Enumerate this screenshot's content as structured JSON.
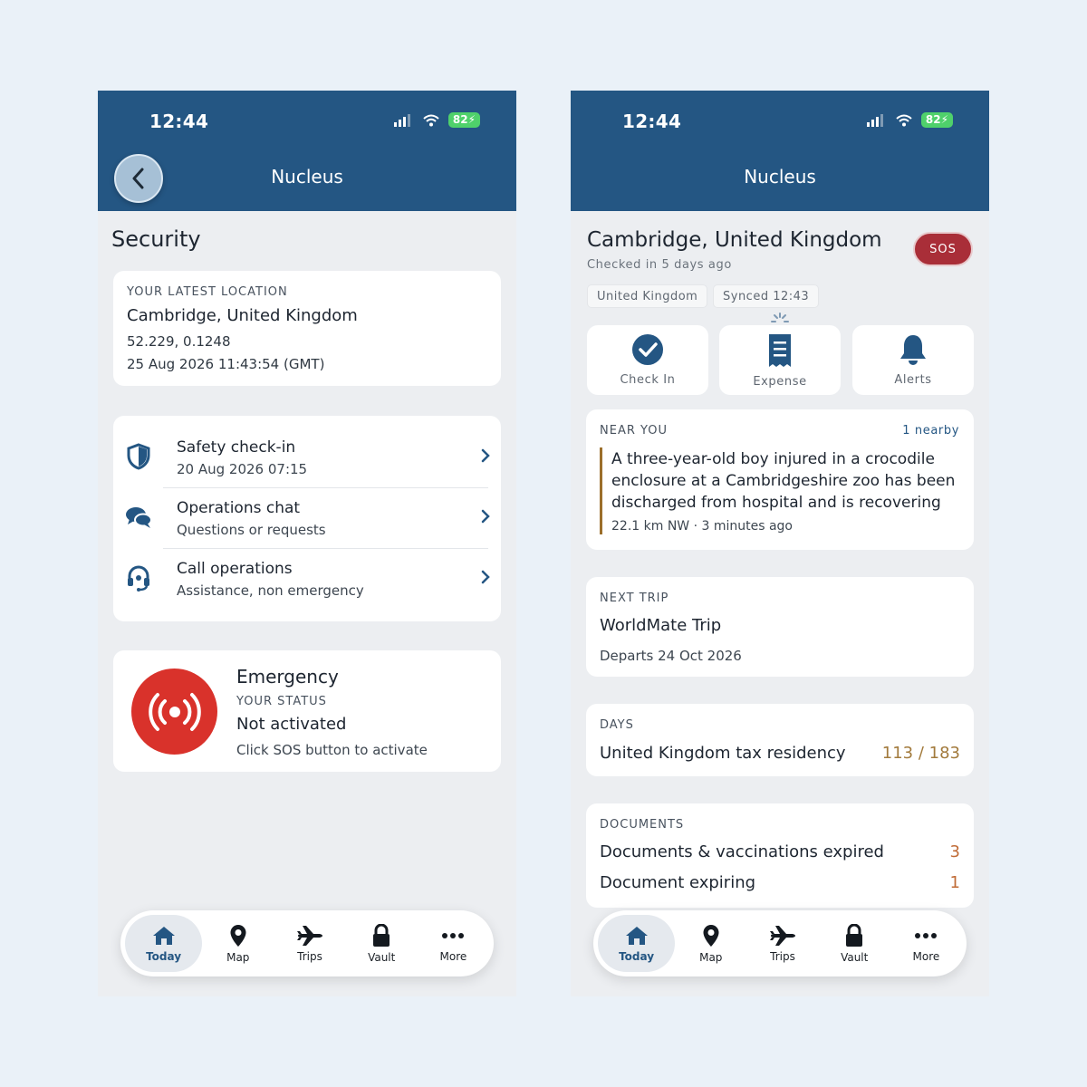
{
  "status_bar": {
    "time": "12:44",
    "battery": "82"
  },
  "left": {
    "header_title": "Nucleus",
    "page_title": "Security",
    "location_card": {
      "caption": "YOUR LATEST LOCATION",
      "place": "Cambridge, United Kingdom",
      "coords": "52.229, 0.1248",
      "timestamp": "25 Aug 2026 11:43:54 (GMT)"
    },
    "list": [
      {
        "title": "Safety check-in",
        "subtitle": "20 Aug 2026 07:15"
      },
      {
        "title": "Operations chat",
        "subtitle": "Questions or requests"
      },
      {
        "title": "Call operations",
        "subtitle": "Assistance, non emergency"
      }
    ],
    "emergency": {
      "title": "Emergency",
      "caption": "YOUR STATUS",
      "status": "Not activated",
      "hint": "Click SOS button to activate"
    }
  },
  "right": {
    "header_title": "Nucleus",
    "place": "Cambridge, United Kingdom",
    "checked_in": "Checked in 5 days ago",
    "sos_label": "SOS",
    "chips": [
      "United Kingdom",
      "Synced 12:43"
    ],
    "quick_actions": [
      "Check In",
      "Expense",
      "Alerts"
    ],
    "near_you": {
      "caption": "NEAR YOU",
      "count": "1 nearby",
      "story": "A three-year-old boy injured in a crocodile enclosure at a Cambridgeshire zoo has been discharged from hospital and is recovering at...",
      "meta": "22.1 km NW · 3 minutes ago"
    },
    "next_trip": {
      "caption": "NEXT TRIP",
      "title": "WorldMate Trip",
      "departs": "Departs 24 Oct 2026"
    },
    "days": {
      "caption": "DAYS",
      "label": "United Kingdom tax residency",
      "value": "113 / 183"
    },
    "documents": {
      "caption": "DOCUMENTS",
      "rows": [
        {
          "label": "Documents & vaccinations expired",
          "value": "3"
        },
        {
          "label": "Document expiring",
          "value": "1"
        }
      ]
    }
  },
  "tabs": [
    "Today",
    "Map",
    "Trips",
    "Vault",
    "More"
  ],
  "colors": {
    "header": "#245683",
    "sos_red": "#d9322b",
    "sos_button": "#a92e38",
    "gold": "#a27a3c",
    "accent_bar": "#9c6f2b"
  },
  "icons": [
    "chevron-left-icon",
    "shield-icon",
    "chat-bubbles-icon",
    "headset-icon",
    "chevron-right-icon",
    "sos-signal-icon",
    "check-circle-icon",
    "receipt-icon",
    "bell-icon",
    "home-icon",
    "map-pin-icon",
    "airplane-icon",
    "lock-icon",
    "ellipsis-icon"
  ]
}
